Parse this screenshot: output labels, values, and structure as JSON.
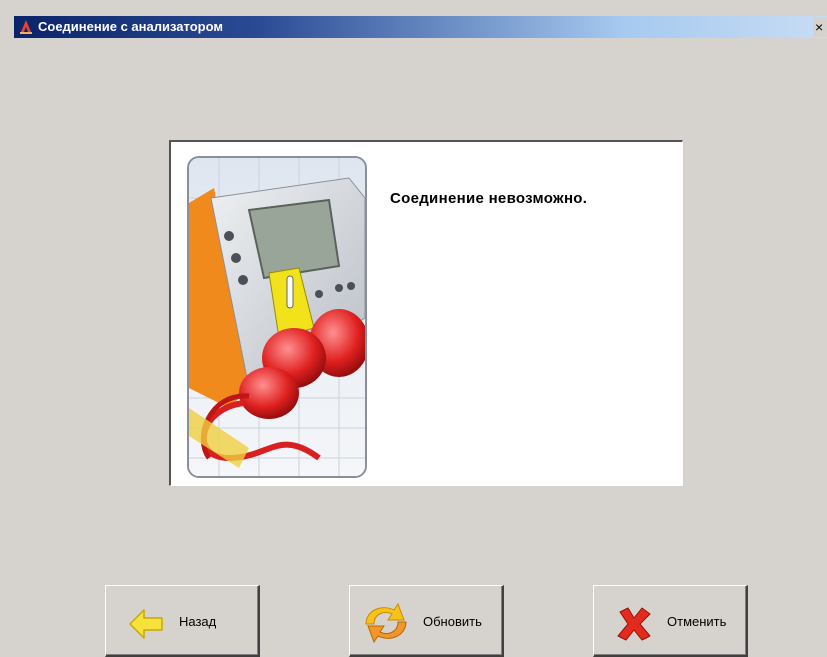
{
  "window": {
    "title": "Соединение с анализатором",
    "close_glyph": "×"
  },
  "content": {
    "message": "Соединение невозможно.",
    "illustration_icon": "analyzer-connection-illustration"
  },
  "buttons": {
    "back": {
      "label": "Назад",
      "icon": "arrow-left-icon"
    },
    "refresh": {
      "label": "Обновить",
      "icon": "refresh-icon"
    },
    "cancel": {
      "label": "Отменить",
      "icon": "cancel-x-icon"
    }
  },
  "colors": {
    "window_bg": "#d6d3ce",
    "titlebar_start": "#0a246a",
    "titlebar_end": "#c8dcf4"
  }
}
